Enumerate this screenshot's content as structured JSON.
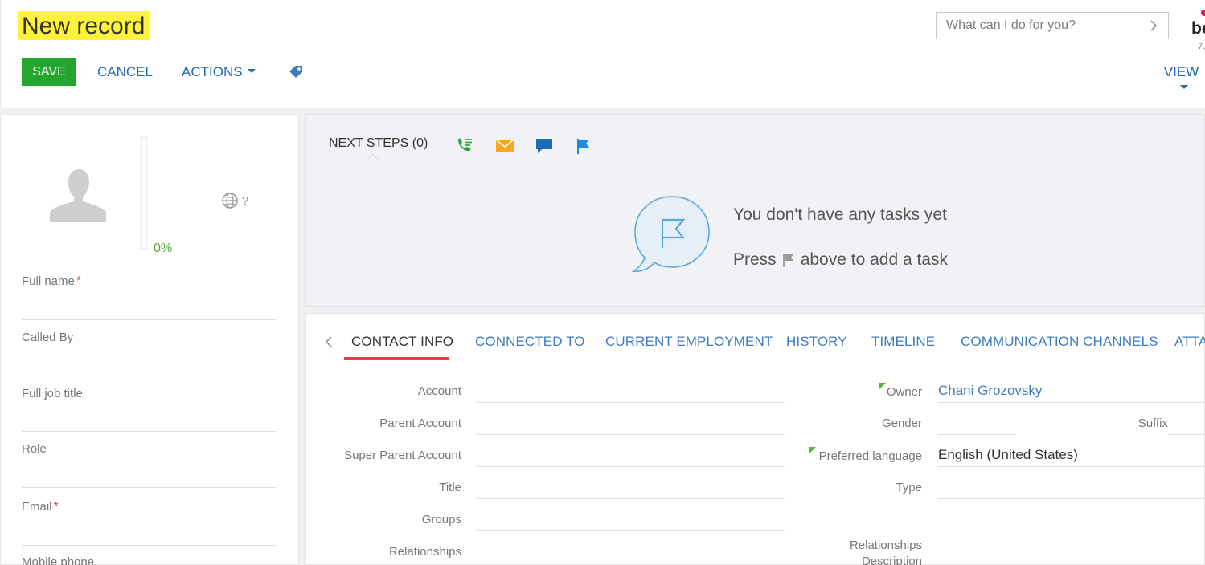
{
  "header": {
    "title": "New record",
    "save_label": "SAVE",
    "cancel_label": "CANCEL",
    "actions_label": "ACTIONS",
    "view_label": "VIEW",
    "search_placeholder": "What can I do for you?",
    "brand_partial": "be",
    "version_partial": "7."
  },
  "profile": {
    "progress_percent": 0,
    "progress_label": "0%",
    "timezone_value": "?"
  },
  "left_fields": [
    {
      "label": "Full name",
      "required": true
    },
    {
      "label": "Called By",
      "required": false
    },
    {
      "label": "Full job title",
      "required": false
    },
    {
      "label": "Role",
      "required": false
    },
    {
      "label": "Email",
      "required": true
    },
    {
      "label": "Mobile phone",
      "required": false
    }
  ],
  "next_steps": {
    "title": "NEXT STEPS (0)",
    "empty_title": "You don't have any tasks yet",
    "empty_hint_before": "Press",
    "empty_hint_after": "above to add a task"
  },
  "tabs": [
    {
      "label": "CONTACT INFO",
      "active": true
    },
    {
      "label": "CONNECTED TO",
      "active": false
    },
    {
      "label": "CURRENT EMPLOYMENT",
      "active": false
    },
    {
      "label": "HISTORY",
      "active": false
    },
    {
      "label": "TIMELINE",
      "active": false
    },
    {
      "label": "COMMUNICATION CHANNELS",
      "active": false
    },
    {
      "label": "ATTA",
      "active": false
    }
  ],
  "contact_info": {
    "left_fields": [
      "Account",
      "Parent Account",
      "Super Parent Account",
      "Title",
      "Groups",
      "Relationships"
    ],
    "owner_label": "Owner",
    "owner_value": "Chani Grozovsky",
    "gender_label": "Gender",
    "suffix_label": "Suffix",
    "language_label": "Preferred language",
    "language_value": "English (United States)",
    "type_label": "Type",
    "rel_desc_line1": "Relationships",
    "rel_desc_line2": "Description"
  },
  "colors": {
    "save_green": "#24a52e",
    "link_blue": "#1f6ab8",
    "active_tab_underline": "#e8413f",
    "title_highlight": "#fff23a",
    "progress_green": "#5aa53b"
  },
  "icons": [
    "tag-icon",
    "chevron-right-icon",
    "avatar-icon",
    "globe-icon",
    "call-icon",
    "email-icon",
    "chat-icon",
    "flag-icon",
    "chevron-left-icon"
  ]
}
